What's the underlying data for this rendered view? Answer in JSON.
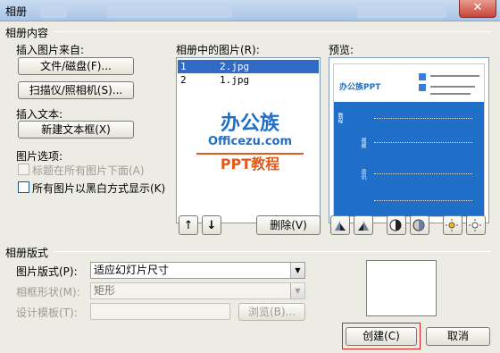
{
  "window": {
    "title": "相册",
    "close_symbol": "✕"
  },
  "album_content": {
    "group_label": "相册内容",
    "insert_from_label": "插入图片来自:",
    "file_disk_button": "文件/磁盘(F)...",
    "scanner_camera_button": "扫描仪/照相机(S)...",
    "insert_text_label": "插入文本:",
    "new_textbox_button": "新建文本框(X)",
    "picture_options_label": "图片选项:",
    "captions_below_all": "标题在所有图片下面(A)",
    "all_black_white": "所有图片以黑白方式显示(K)"
  },
  "pictures_in_album": {
    "label": "相册中的图片(R):",
    "items": [
      {
        "number": "1",
        "file": "2.jpg",
        "selected": true
      },
      {
        "number": "2",
        "file": "1.jpg",
        "selected": false
      }
    ],
    "delete_button": "删除(V)",
    "move_up_icon": "arrow-up-icon",
    "move_down_icon": "arrow-down-icon"
  },
  "preview": {
    "label": "预览:",
    "slide": {
      "logo_text": "办公族PPT",
      "side_labels": [
        "教程",
        "视频",
        "资讯"
      ]
    },
    "tool_icons": [
      "rotate-left-icon",
      "rotate-right-icon",
      "contrast-up-icon",
      "contrast-down-icon",
      "brightness-up-icon",
      "brightness-down-icon"
    ]
  },
  "watermark": {
    "brand": "办公族",
    "site": "Officezu.com",
    "tagline": "PPT教程"
  },
  "album_layout": {
    "group_label": "相册版式",
    "picture_layout_label": "图片版式(P):",
    "picture_layout_value": "适应幻灯片尺寸",
    "frame_shape_label": "相框形状(M):",
    "frame_shape_value": "矩形",
    "design_template_label": "设计模板(T):",
    "design_template_value": "",
    "browse_button": "浏览(B)..."
  },
  "footer": {
    "create_button": "创建(C)",
    "cancel_button": "取消"
  },
  "colors": {
    "accent": "#316ac5",
    "highlight": "#e02020",
    "slide_blue": "#1f6fc9"
  }
}
